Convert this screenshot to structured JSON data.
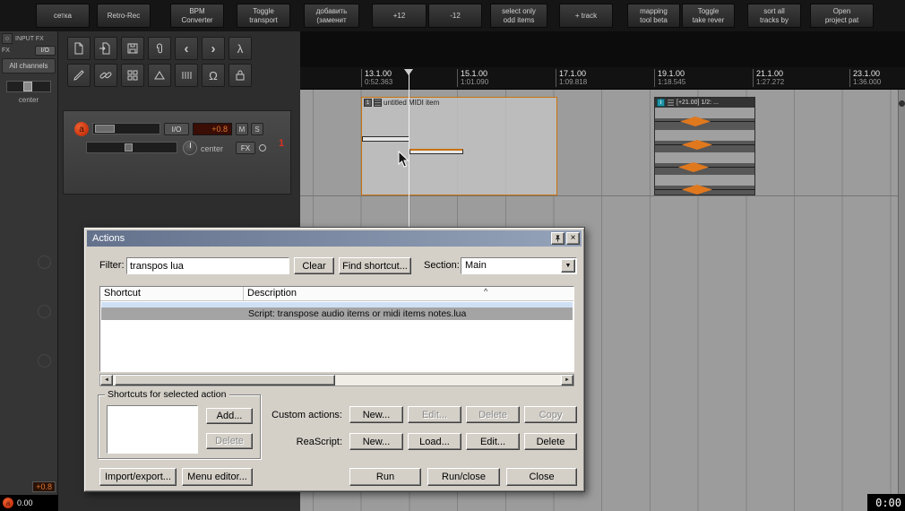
{
  "top_toolbar": {
    "buttons": [
      "сетка",
      "Retro-Rec",
      "BPM\nConverter",
      "Toggle\ntransport",
      "добавить\n(заменит",
      "+12",
      "-12",
      "select only\nodd items",
      "+ track",
      "mapping\ntool beta",
      "Toggle\ntake rever",
      "sort all\ntracks by",
      "Open\nproject pat"
    ]
  },
  "icons": {
    "back": "‹",
    "forward": "›",
    "lambda": "λ",
    "omega": "Ω",
    "combo_arrow": "▼",
    "scroll_left": "◄",
    "scroll_right": "►",
    "close": "×",
    "sort_caret": "^",
    "power": "○"
  },
  "sidebar": {
    "input_fx": "INPUT FX",
    "fx": "FX",
    "io": "I/O",
    "all_channels": "All channels",
    "pan": "center",
    "gain": "+0.8",
    "meter": "0.00",
    "rec": "a"
  },
  "tcp": {
    "rec": "a",
    "io": "I/O",
    "volume": "+0.8",
    "mute": "M",
    "solo": "S",
    "pan": "center",
    "fx": "FX",
    "track_num": "1"
  },
  "ruler": {
    "marks": [
      {
        "bar": "13.1.00",
        "time": "0:52.363"
      },
      {
        "bar": "15.1.00",
        "time": "1:01.090"
      },
      {
        "bar": "17.1.00",
        "time": "1:09.818"
      },
      {
        "bar": "19.1.00",
        "time": "1:18.545"
      },
      {
        "bar": "21.1.00",
        "time": "1:27.272"
      },
      {
        "bar": "23.1.00",
        "time": "1:36.000"
      }
    ]
  },
  "arrange": {
    "midi_item": {
      "badge": "1",
      "title": "untitled MIDI item"
    },
    "stretch_item": {
      "badge": "i",
      "label": "[+21.00] 1/2: ..."
    }
  },
  "dialog": {
    "title": "Actions",
    "filter_label": "Filter:",
    "filter_value": "transpos lua",
    "clear": "Clear",
    "find_shortcut": "Find shortcut...",
    "section_label": "Section:",
    "section_value": "Main",
    "columns": [
      "Shortcut",
      "Description"
    ],
    "selected_row": "Script: transpose audio items or midi items notes.lua",
    "group_label": "Shortcuts for selected action",
    "add": "Add...",
    "delete": "Delete",
    "custom_actions_label": "Custom actions:",
    "ca_new": "New...",
    "ca_edit": "Edit...",
    "ca_delete": "Delete",
    "ca_copy": "Copy",
    "reascript_label": "ReaScript:",
    "rs_new": "New...",
    "rs_load": "Load...",
    "rs_edit": "Edit...",
    "rs_delete": "Delete",
    "import_export": "Import/export...",
    "menu_editor": "Menu editor...",
    "run": "Run",
    "run_close": "Run/close",
    "close": "Close"
  },
  "status": {
    "time": "0:00"
  },
  "colors": {
    "accent_orange": "#e0781e",
    "item_border": "#c8720e",
    "titlebar": "#63718c",
    "selection": "#a4a4a4"
  }
}
